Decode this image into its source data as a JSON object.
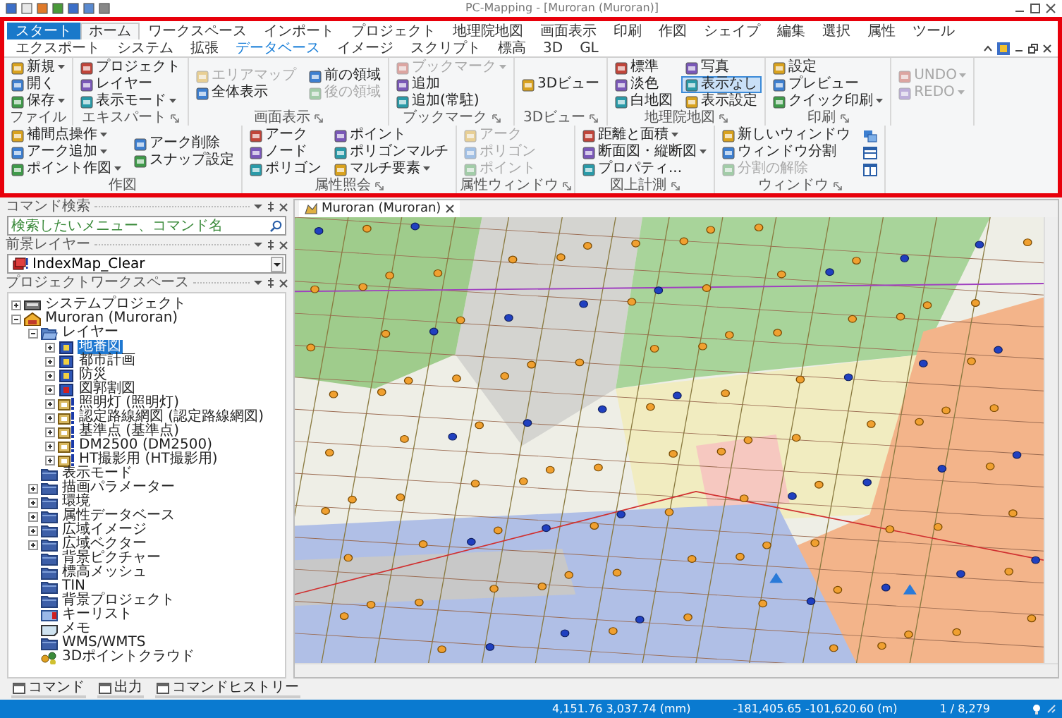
{
  "window": {
    "title": "PC-Mapping - [Muroran (Muroran)]"
  },
  "ribbon_tabs": [
    {
      "label": "スタート",
      "kind": "app",
      "selected": false
    },
    {
      "label": "ホーム",
      "kind": "tab",
      "selected": true
    },
    {
      "label": "ワークスペース",
      "kind": "tab",
      "selected": false
    },
    {
      "label": "インポート",
      "kind": "tab",
      "selected": false
    },
    {
      "label": "プロジェクト",
      "kind": "tab",
      "selected": false
    },
    {
      "label": "地理院地図",
      "kind": "tab",
      "selected": false
    },
    {
      "label": "画面表示",
      "kind": "tab",
      "selected": false
    },
    {
      "label": "印刷",
      "kind": "tab",
      "selected": false
    },
    {
      "label": "作図",
      "kind": "tab",
      "selected": false
    },
    {
      "label": "シェイプ",
      "kind": "tab",
      "selected": false
    },
    {
      "label": "編集",
      "kind": "tab",
      "selected": false
    },
    {
      "label": "選択",
      "kind": "tab",
      "selected": false
    },
    {
      "label": "属性",
      "kind": "tab",
      "selected": false
    },
    {
      "label": "ツール",
      "kind": "tab",
      "selected": false
    },
    {
      "label": "エクスポート",
      "kind": "tab",
      "selected": false
    },
    {
      "label": "システム",
      "kind": "tab",
      "selected": false
    },
    {
      "label": "拡張",
      "kind": "tab",
      "selected": false
    },
    {
      "label": "データベース",
      "kind": "context",
      "selected": false
    },
    {
      "label": "イメージ",
      "kind": "tab",
      "selected": false
    },
    {
      "label": "スクリプト",
      "kind": "tab",
      "selected": false
    },
    {
      "label": "標高",
      "kind": "tab",
      "selected": false
    },
    {
      "label": "3D",
      "kind": "tab",
      "selected": false
    },
    {
      "label": "GL",
      "kind": "tab",
      "selected": false
    }
  ],
  "ribbon_groups": [
    {
      "label": "ファイル",
      "launcher": false,
      "columns": [
        [
          {
            "kind": "button",
            "label": "新規",
            "dropdown": true,
            "disabled": false,
            "selected": false
          },
          {
            "kind": "button",
            "label": "開く",
            "dropdown": false,
            "disabled": false,
            "selected": false
          },
          {
            "kind": "button",
            "label": "保存",
            "dropdown": true,
            "disabled": false,
            "selected": false
          }
        ]
      ]
    },
    {
      "label": "エキスパート",
      "launcher": true,
      "columns": [
        [
          {
            "kind": "button",
            "label": "プロジェクト",
            "dropdown": false,
            "disabled": false,
            "selected": false
          },
          {
            "kind": "button",
            "label": "レイヤー",
            "dropdown": false,
            "disabled": false,
            "selected": false
          },
          {
            "kind": "button",
            "label": "表示モード",
            "dropdown": true,
            "disabled": false,
            "selected": false
          }
        ]
      ]
    },
    {
      "label": "画面表示",
      "launcher": true,
      "columns": [
        [
          {
            "kind": "button",
            "label": "エリアマップ",
            "dropdown": false,
            "disabled": true,
            "selected": false
          },
          {
            "kind": "button",
            "label": "全体表示",
            "dropdown": false,
            "disabled": false,
            "selected": false
          }
        ],
        [
          {
            "kind": "button",
            "label": "前の領域",
            "dropdown": false,
            "disabled": false,
            "selected": false
          },
          {
            "kind": "button",
            "label": "後の領域",
            "dropdown": false,
            "disabled": true,
            "selected": false
          }
        ]
      ]
    },
    {
      "label": "ブックマーク",
      "launcher": true,
      "columns": [
        [
          {
            "kind": "button",
            "label": "ブックマーク",
            "dropdown": true,
            "disabled": true,
            "selected": false
          },
          {
            "kind": "button",
            "label": "追加",
            "dropdown": false,
            "disabled": false,
            "selected": false
          },
          {
            "kind": "button",
            "label": "追加(常駐)",
            "dropdown": false,
            "disabled": false,
            "selected": false
          }
        ]
      ]
    },
    {
      "label": "3Dビュー",
      "launcher": true,
      "columns": [
        [
          {
            "kind": "button",
            "label": "3Dビュー",
            "dropdown": false,
            "disabled": false,
            "selected": false
          }
        ]
      ]
    },
    {
      "label": "地理院地図",
      "launcher": true,
      "columns": [
        [
          {
            "kind": "button",
            "label": "標準",
            "dropdown": false,
            "disabled": false,
            "selected": false
          },
          {
            "kind": "button",
            "label": "淡色",
            "dropdown": false,
            "disabled": false,
            "selected": false
          },
          {
            "kind": "button",
            "label": "白地図",
            "dropdown": false,
            "disabled": false,
            "selected": false
          }
        ],
        [
          {
            "kind": "button",
            "label": "写真",
            "dropdown": false,
            "disabled": false,
            "selected": false
          },
          {
            "kind": "button",
            "label": "表示なし",
            "dropdown": false,
            "disabled": false,
            "selected": true
          },
          {
            "kind": "button",
            "label": "表示設定",
            "dropdown": false,
            "disabled": false,
            "selected": false
          }
        ]
      ]
    },
    {
      "label": "印刷",
      "launcher": true,
      "columns": [
        [
          {
            "kind": "button",
            "label": "設定",
            "dropdown": false,
            "disabled": false,
            "selected": false
          },
          {
            "kind": "button",
            "label": "プレビュー",
            "dropdown": false,
            "disabled": false,
            "selected": false
          },
          {
            "kind": "button",
            "label": "クイック印刷",
            "dropdown": true,
            "disabled": false,
            "selected": false
          }
        ]
      ]
    },
    {
      "columns": [
        [
          {
            "kind": "button",
            "label": "UNDO",
            "dropdown": true,
            "disabled": true,
            "selected": false
          },
          {
            "kind": "button",
            "label": "REDO",
            "dropdown": true,
            "disabled": true,
            "selected": false
          }
        ]
      ]
    },
    {
      "label": "作図",
      "launcher": false,
      "columns": [
        [
          {
            "kind": "button",
            "label": "補間点操作",
            "dropdown": true,
            "disabled": false,
            "selected": false
          },
          {
            "kind": "button",
            "label": "アーク追加",
            "dropdown": true,
            "disabled": false,
            "selected": false
          },
          {
            "kind": "button",
            "label": "ポイント作図",
            "dropdown": true,
            "disabled": false,
            "selected": false
          }
        ],
        [
          {
            "kind": "button",
            "label": "アーク削除",
            "dropdown": false,
            "disabled": false,
            "selected": false
          },
          {
            "kind": "button",
            "label": "スナップ設定",
            "dropdown": false,
            "disabled": false,
            "selected": false
          }
        ]
      ]
    },
    {
      "label": "属性照会",
      "launcher": true,
      "columns": [
        [
          {
            "kind": "button",
            "label": "アーク",
            "dropdown": false,
            "disabled": false,
            "selected": false
          },
          {
            "kind": "button",
            "label": "ノード",
            "dropdown": false,
            "disabled": false,
            "selected": false
          },
          {
            "kind": "button",
            "label": "ポリゴン",
            "dropdown": false,
            "disabled": false,
            "selected": false
          }
        ],
        [
          {
            "kind": "button",
            "label": "ポイント",
            "dropdown": false,
            "disabled": false,
            "selected": false
          },
          {
            "kind": "button",
            "label": "ポリゴンマルチ",
            "dropdown": false,
            "disabled": false,
            "selected": false
          },
          {
            "kind": "button",
            "label": "マルチ要素",
            "dropdown": true,
            "disabled": false,
            "selected": false
          }
        ]
      ]
    },
    {
      "label": "属性ウィンドウ",
      "launcher": true,
      "columns": [
        [
          {
            "kind": "button",
            "label": "アーク",
            "dropdown": false,
            "disabled": true,
            "selected": false
          },
          {
            "kind": "button",
            "label": "ポリゴン",
            "dropdown": false,
            "disabled": true,
            "selected": false
          },
          {
            "kind": "button",
            "label": "ポイント",
            "dropdown": false,
            "disabled": true,
            "selected": false
          }
        ]
      ]
    },
    {
      "label": "図上計測",
      "launcher": true,
      "columns": [
        [
          {
            "kind": "button",
            "label": "距離と面積",
            "dropdown": true,
            "disabled": false,
            "selected": false
          },
          {
            "kind": "button",
            "label": "断面図・縦断図",
            "dropdown": true,
            "disabled": false,
            "selected": false
          },
          {
            "kind": "button",
            "label": "プロパティ...",
            "dropdown": false,
            "disabled": false,
            "selected": false
          }
        ]
      ]
    },
    {
      "label": "ウィンドウ",
      "launcher": true,
      "columns": [
        [
          {
            "kind": "button",
            "label": "新しいウィンドウ",
            "dropdown": false,
            "disabled": false,
            "selected": false
          },
          {
            "kind": "button",
            "label": "ウィンドウ分割",
            "dropdown": false,
            "disabled": false,
            "selected": false
          },
          {
            "kind": "button",
            "label": "分割の解除",
            "dropdown": false,
            "disabled": true,
            "selected": false
          }
        ],
        [
          {
            "kind": "cascade",
            "disabled": false,
            "selected": false
          },
          {
            "kind": "split-horizontal",
            "disabled": false,
            "selected": false
          },
          {
            "kind": "split-vertical",
            "disabled": false,
            "selected": false
          }
        ]
      ]
    }
  ],
  "command_search": {
    "title": "コマンド検索",
    "placeholder": "検索したいメニュー、コマンド名"
  },
  "foreground_layer": {
    "title": "前景レイヤー",
    "value": "IndexMap_Clear"
  },
  "project_workspace": {
    "title": "プロジェクトワークスペース",
    "tree": [
      {
        "label": "システムプロジェクト",
        "kind": "system",
        "expander": true,
        "expanded": false,
        "selected": false
      },
      {
        "label": "Muroran (Muroran)",
        "kind": "project",
        "expander": true,
        "expanded": true,
        "selected": false,
        "children": [
          {
            "label": "レイヤー",
            "kind": "open-folder",
            "expander": true,
            "expanded": true,
            "selected": false,
            "children": [
              {
                "label": "地番図",
                "kind": "layer",
                "expander": true,
                "expanded": false,
                "selected": true
              },
              {
                "label": "都市計画",
                "kind": "layer",
                "expander": true,
                "expanded": false,
                "selected": false
              },
              {
                "label": "防災",
                "kind": "layer",
                "expander": true,
                "expanded": false,
                "selected": false
              },
              {
                "label": "図郭割図",
                "kind": "layer-red",
                "expander": true,
                "expanded": false,
                "selected": false
              },
              {
                "label": "照明灯 (照明灯)",
                "kind": "linked-layer",
                "expander": true,
                "expanded": false,
                "selected": false
              },
              {
                "label": "認定路線網図 (認定路線網図)",
                "kind": "linked-layer",
                "expander": true,
                "expanded": false,
                "selected": false
              },
              {
                "label": "基準点 (基準点)",
                "kind": "linked-layer",
                "expander": true,
                "expanded": false,
                "selected": false
              },
              {
                "label": "DM2500 (DM2500)",
                "kind": "linked-layer",
                "expander": true,
                "expanded": false,
                "selected": false
              },
              {
                "label": "HT撮影用 (HT撮影用)",
                "kind": "linked-layer",
                "expander": true,
                "expanded": false,
                "selected": false
              }
            ]
          },
          {
            "label": "表示モード",
            "kind": "folder",
            "expander": false,
            "selected": false
          },
          {
            "label": "描画パラメーター",
            "kind": "folder",
            "expander": true,
            "expanded": false,
            "selected": false
          },
          {
            "label": "環境",
            "kind": "folder",
            "expander": true,
            "expanded": false,
            "selected": false
          },
          {
            "label": "属性データベース",
            "kind": "folder",
            "expander": true,
            "expanded": false,
            "selected": false
          },
          {
            "label": "広域イメージ",
            "kind": "folder",
            "expander": true,
            "expanded": false,
            "selected": false
          },
          {
            "label": "広域ベクター",
            "kind": "folder",
            "expander": true,
            "expanded": false,
            "selected": false
          },
          {
            "label": "背景ピクチャー",
            "kind": "folder",
            "expander": false,
            "selected": false
          },
          {
            "label": "標高メッシュ",
            "kind": "folder",
            "expander": false,
            "selected": false
          },
          {
            "label": "TIN",
            "kind": "folder",
            "expander": false,
            "selected": false
          },
          {
            "label": "背景プロジェクト",
            "kind": "folder",
            "expander": false,
            "selected": false
          },
          {
            "label": "キーリスト",
            "kind": "keylist",
            "expander": false,
            "selected": false
          },
          {
            "label": "メモ",
            "kind": "memo",
            "expander": false,
            "selected": false
          },
          {
            "label": "WMS/WMTS",
            "kind": "folder",
            "expander": false,
            "selected": false
          },
          {
            "label": "3Dポイントクラウド",
            "kind": "pointcloud",
            "expander": false,
            "selected": false
          }
        ]
      }
    ]
  },
  "map_tab": {
    "label": "Muroran (Muroran)"
  },
  "bottom_tabs": [
    {
      "label": "コマンド"
    },
    {
      "label": "出力"
    },
    {
      "label": "コマンドヒストリー"
    }
  ],
  "status_bar": {
    "readouts": [
      "4,151.76 3,037.74 (mm)",
      "-181,405.65 -101,620.60 (m)",
      "1 / 8,279"
    ]
  }
}
